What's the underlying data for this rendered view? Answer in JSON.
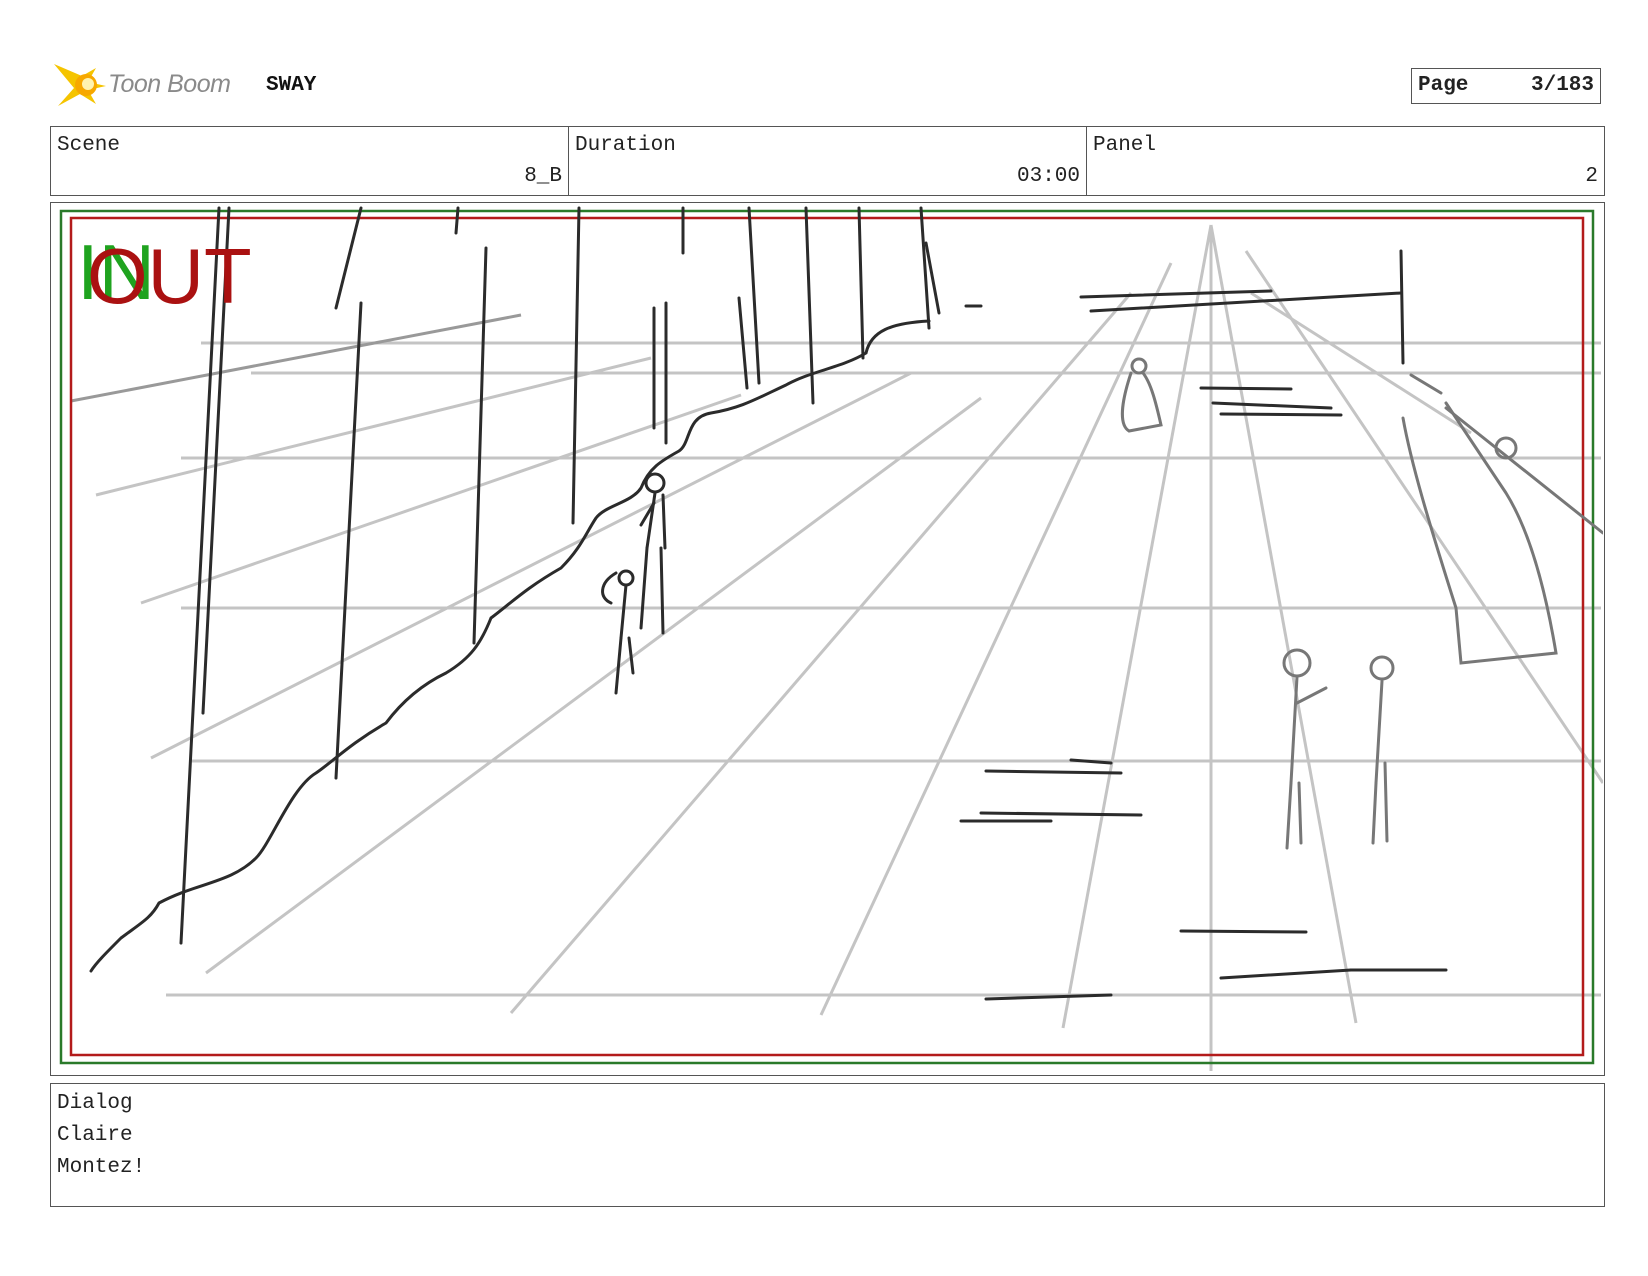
{
  "header": {
    "logo_text": "Toon Boom",
    "project_title": "SWAY",
    "page_label": "Page",
    "page_value": "3/183"
  },
  "info": {
    "scene_label": "Scene",
    "scene_value": "8_B",
    "duration_label": "Duration",
    "duration_value": "03:00",
    "panel_label": "Panel",
    "panel_value": "2"
  },
  "panel": {
    "in_marker": "IN",
    "out_marker": "OUT",
    "colors": {
      "in_marker": "#1fa31f",
      "out_marker": "#aa1111",
      "safe_frame": "#b31b1b",
      "action_frame": "#2a7a2a",
      "guide_lines": "#c4c4c4",
      "ink": "#2b2b2b"
    }
  },
  "dialog": {
    "label": "Dialog",
    "speaker": "Claire",
    "line": "Montez!"
  }
}
